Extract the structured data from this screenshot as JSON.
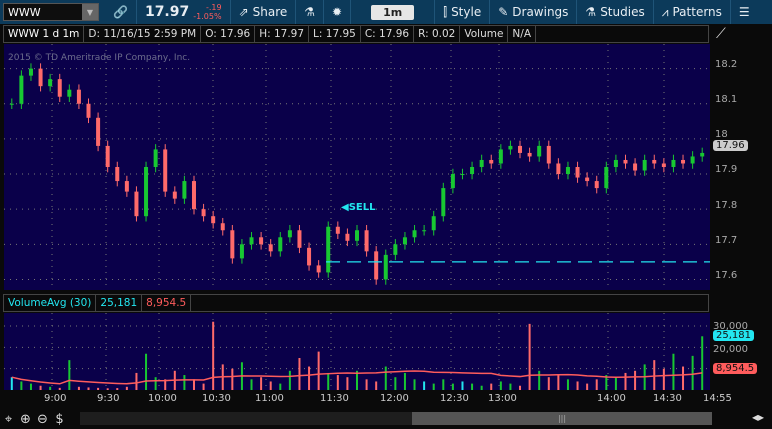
{
  "toolbar": {
    "symbol": "WWW",
    "last": "17.97",
    "change": "-.19",
    "change_pct": "-1.05%",
    "share": "Share",
    "timeframe": "1m",
    "style": "Style",
    "drawings": "Drawings",
    "studies": "Studies",
    "patterns": "Patterns"
  },
  "info": {
    "title": "WWW 1 d 1m",
    "date": "D: 11/16/15 2:59 PM",
    "open": "O: 17.96",
    "high": "H: 17.97",
    "low": "L: 17.95",
    "close": "C: 17.96",
    "range": "R: 0.02",
    "volume_label": "Volume",
    "volume_value": "N/A"
  },
  "watermark": "2015 © TD Ameritrade IP Company, Inc.",
  "price_axis": [
    "18.2",
    "18.1",
    "18",
    "17.9",
    "17.8",
    "17.7",
    "17.6"
  ],
  "current_price_tag": "17.96",
  "sell_label": "SELL",
  "volume_study": {
    "name": "VolumeAvg (30)",
    "volume": "25,181",
    "avg": "8,954.5",
    "axis": [
      "30,000",
      "20,000"
    ],
    "volume_color": "#23e6f0",
    "avg_color": "#ff5c5c"
  },
  "time_axis": [
    "9:00",
    "9:30",
    "10:00",
    "10:30",
    "11:00",
    "11:30",
    "12:00",
    "12:30",
    "13:00",
    "14:00",
    "14:30",
    "14:55"
  ],
  "colors": {
    "up": "#18c832",
    "down": "#ff6a6a",
    "background": "#0a004a"
  },
  "chart_data": {
    "type": "candlestick",
    "ylim": [
      17.57,
      18.27
    ],
    "closes": [
      18.1,
      18.18,
      18.2,
      18.15,
      18.17,
      18.12,
      18.14,
      18.1,
      18.06,
      17.98,
      17.92,
      17.88,
      17.85,
      17.78,
      17.92,
      17.97,
      17.85,
      17.83,
      17.88,
      17.8,
      17.78,
      17.76,
      17.74,
      17.66,
      17.7,
      17.72,
      17.7,
      17.68,
      17.72,
      17.74,
      17.69,
      17.64,
      17.62,
      17.75,
      17.73,
      17.71,
      17.74,
      17.68,
      17.6,
      17.67,
      17.7,
      17.72,
      17.74,
      17.74,
      17.78,
      17.86,
      17.9,
      17.9,
      17.92,
      17.94,
      17.93,
      17.97,
      17.98,
      17.96,
      17.95,
      17.98,
      17.93,
      17.9,
      17.92,
      17.89,
      17.88,
      17.86,
      17.92,
      17.94,
      17.93,
      17.91,
      17.94,
      17.93,
      17.92,
      17.94,
      17.93,
      17.95,
      17.96
    ],
    "volumes": [
      6000,
      4000,
      3000,
      2000,
      1500,
      1000,
      14000,
      1500,
      1200,
      1000,
      800,
      900,
      1500,
      8000,
      17000,
      6000,
      5000,
      9000,
      7000,
      5000,
      3000,
      32000,
      12000,
      10000,
      13000,
      5000,
      6000,
      4000,
      3000,
      9000,
      15000,
      11000,
      18000,
      8000,
      7000,
      6000,
      9000,
      5000,
      4000,
      11000,
      6000,
      8000,
      5000,
      4000,
      3000,
      5000,
      3000,
      4000,
      3000,
      2000,
      3000,
      4000,
      3000,
      2000,
      31000,
      9000,
      6000,
      7000,
      5000,
      4000,
      3000,
      5000,
      7000,
      6000,
      8000,
      9000,
      12000,
      14000,
      10000,
      17000,
      11000,
      16000,
      25181
    ]
  }
}
